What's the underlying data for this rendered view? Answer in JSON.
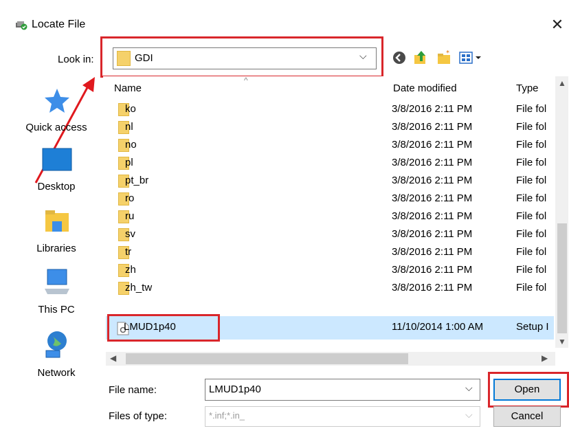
{
  "window": {
    "title": "Locate File",
    "close_glyph": "✕"
  },
  "lookin": {
    "label": "Look in:",
    "value": "GDI",
    "arrow": "⌵"
  },
  "toolbar": {
    "icons": [
      "back-icon",
      "up-folder-icon",
      "new-folder-icon",
      "view-menu-icon"
    ]
  },
  "places": [
    "Quick access",
    "Desktop",
    "Libraries",
    "This PC",
    "Network"
  ],
  "columns": {
    "name": "Name",
    "date": "Date modified",
    "type": "Type"
  },
  "rows": [
    {
      "name": "ko",
      "date": "3/8/2016 2:11 PM",
      "type": "File fol"
    },
    {
      "name": "nl",
      "date": "3/8/2016 2:11 PM",
      "type": "File fol"
    },
    {
      "name": "no",
      "date": "3/8/2016 2:11 PM",
      "type": "File fol"
    },
    {
      "name": "pl",
      "date": "3/8/2016 2:11 PM",
      "type": "File fol"
    },
    {
      "name": "pt_br",
      "date": "3/8/2016 2:11 PM",
      "type": "File fol"
    },
    {
      "name": "ro",
      "date": "3/8/2016 2:11 PM",
      "type": "File fol"
    },
    {
      "name": "ru",
      "date": "3/8/2016 2:11 PM",
      "type": "File fol"
    },
    {
      "name": "sv",
      "date": "3/8/2016 2:11 PM",
      "type": "File fol"
    },
    {
      "name": "tr",
      "date": "3/8/2016 2:11 PM",
      "type": "File fol"
    },
    {
      "name": "zh",
      "date": "3/8/2016 2:11 PM",
      "type": "File fol"
    },
    {
      "name": "zh_tw",
      "date": "3/8/2016 2:11 PM",
      "type": "File fol"
    },
    {
      "name": "LMUD1p40",
      "date": "11/10/2014 1:00 AM",
      "type": "Setup I"
    }
  ],
  "filename": {
    "label": "File name:",
    "value": "LMUD1p40"
  },
  "filetype": {
    "label": "Files of type:",
    "value": "*.inf;*.in_"
  },
  "buttons": {
    "open": "Open",
    "cancel": "Cancel"
  },
  "annotation_color": "#d9262b",
  "accent_color": "#0078d7"
}
